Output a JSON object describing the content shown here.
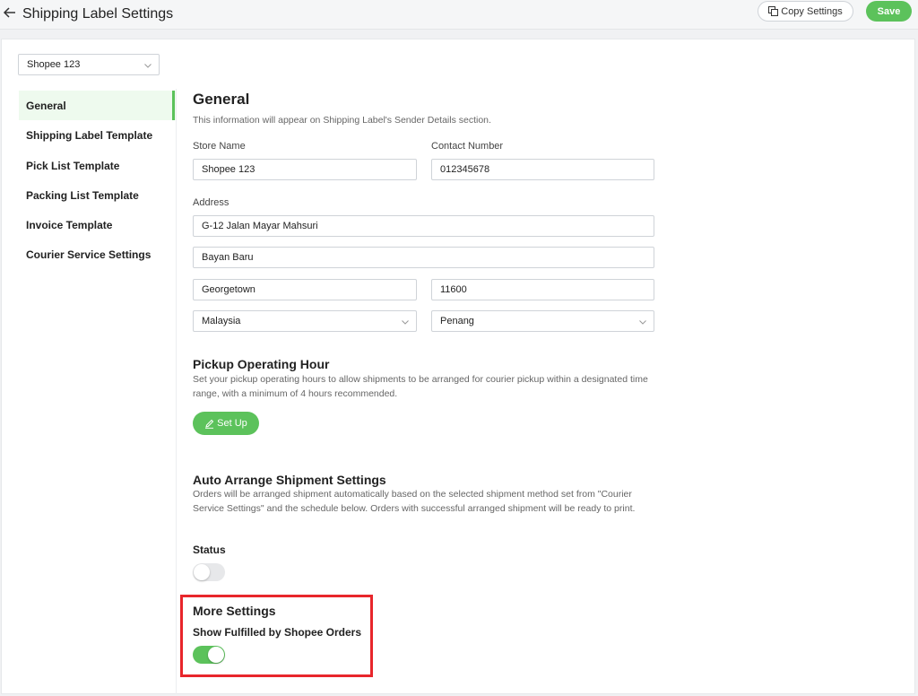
{
  "header": {
    "title": "Shipping Label Settings",
    "copy_label": "Copy Settings",
    "save_label": "Save"
  },
  "store_selector": {
    "value": "Shopee 123"
  },
  "sidebar": {
    "items": [
      {
        "label": "General",
        "active": true
      },
      {
        "label": "Shipping Label Template",
        "active": false
      },
      {
        "label": "Pick List Template",
        "active": false
      },
      {
        "label": "Packing List Template",
        "active": false
      },
      {
        "label": "Invoice Template",
        "active": false
      },
      {
        "label": "Courier Service Settings",
        "active": false
      }
    ]
  },
  "general": {
    "title": "General",
    "description": "This information will appear on Shipping Label's Sender Details section.",
    "store_name_label": "Store Name",
    "store_name_value": "Shopee 123",
    "contact_label": "Contact Number",
    "contact_value": "012345678",
    "address_label": "Address",
    "address_line1": "G-12 Jalan Mayar Mahsuri",
    "address_line2": "Bayan Baru",
    "city": "Georgetown",
    "postcode": "11600",
    "country": "Malaysia",
    "state": "Penang"
  },
  "pickup": {
    "title": "Pickup Operating Hour",
    "description": "Set your pickup operating hours to allow shipments to be arranged for courier pickup within a designated time range, with a minimum of 4 hours recommended.",
    "setup_label": "Set Up"
  },
  "auto_arrange": {
    "title": "Auto Arrange Shipment Settings",
    "description": "Orders will be arranged shipment automatically based on the selected shipment method set from \"Courier Service Settings\" and the schedule below. Orders with successful arranged shipment will be ready to print.",
    "status_label": "Status",
    "status_on": false
  },
  "more_settings": {
    "title": "More Settings",
    "fbs_label": "Show Fulfilled by Shopee Orders",
    "fbs_on": true
  },
  "colors": {
    "accent": "#5cc25b",
    "highlight": "#e8262b"
  }
}
